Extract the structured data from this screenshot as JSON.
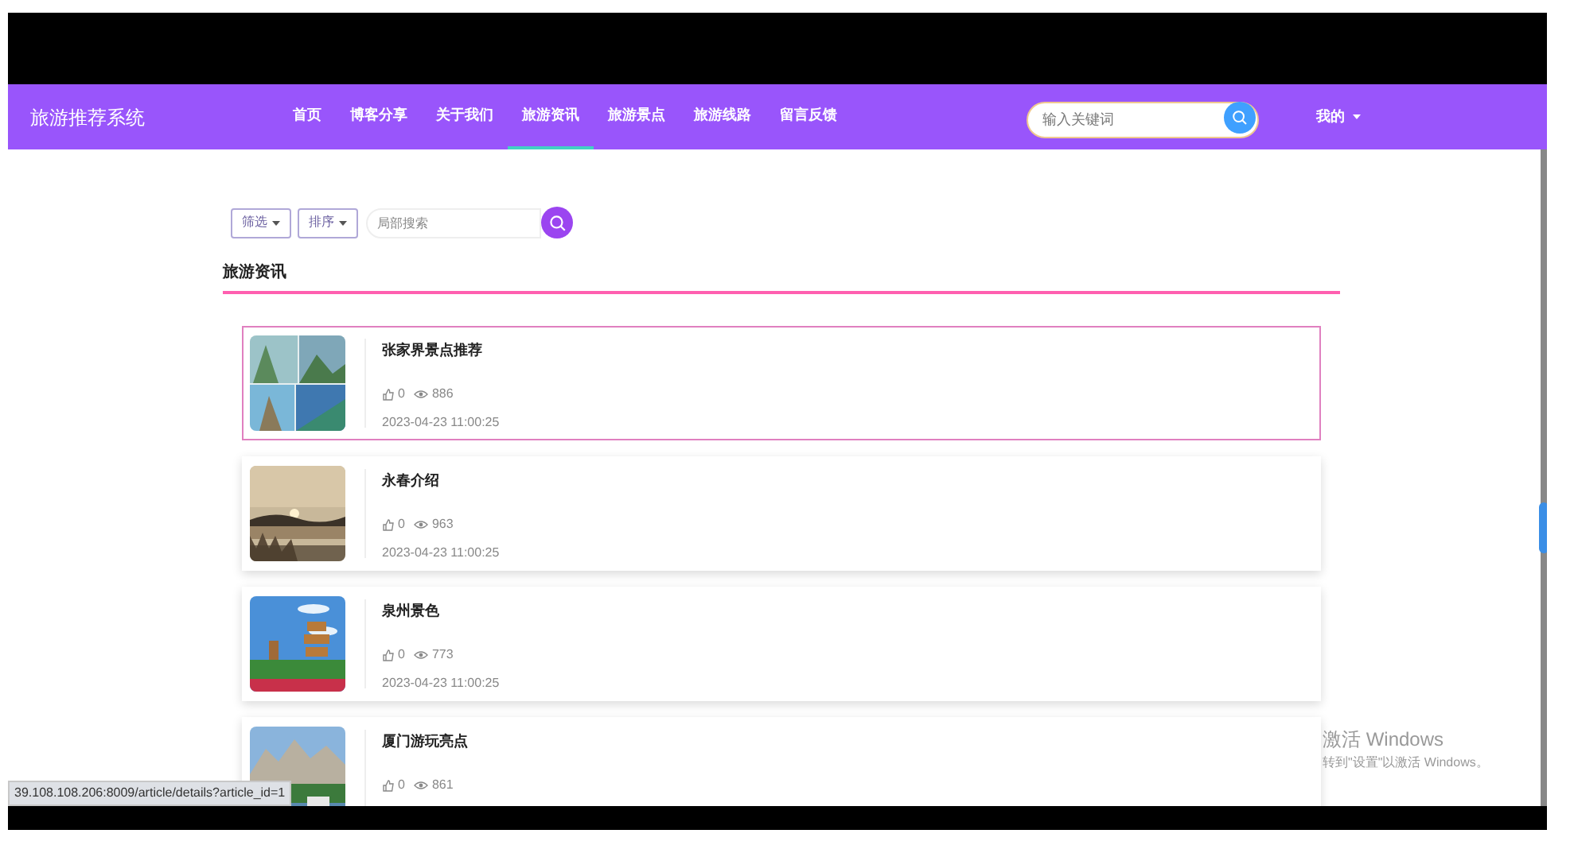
{
  "header": {
    "brand": "旅游推荐系统",
    "nav": [
      {
        "label": "首页",
        "selected": false
      },
      {
        "label": "博客分享",
        "selected": false
      },
      {
        "label": "关于我们",
        "selected": false
      },
      {
        "label": "旅游资讯",
        "selected": true
      },
      {
        "label": "旅游景点",
        "selected": false
      },
      {
        "label": "旅游线路",
        "selected": false
      },
      {
        "label": "留言反馈",
        "selected": false
      }
    ],
    "search": {
      "placeholder": "输入关键词"
    },
    "user_menu": "我的"
  },
  "toolbar": {
    "dropdowns": [
      "筛选",
      "排序"
    ],
    "search": {
      "placeholder": "局部搜索"
    }
  },
  "section_title": "旅游资讯",
  "articles": [
    {
      "title": "张家界景点推荐",
      "likes": "0",
      "views": "886",
      "date": "2023-04-23 11:00:25",
      "hovered": true
    },
    {
      "title": "永春介绍",
      "likes": "0",
      "views": "963",
      "date": "2023-04-23 11:00:25",
      "hovered": false
    },
    {
      "title": "泉州景色",
      "likes": "0",
      "views": "773",
      "date": "2023-04-23 11:00:25",
      "hovered": false
    },
    {
      "title": "厦门游玩亮点",
      "likes": "0",
      "views": "861",
      "hovered": false
    }
  ],
  "status_url": "39.108.108.206:8009/article/details?article_id=1",
  "windows_notice": {
    "title": "激活 Windows",
    "subtitle": "转到\"设置\"以激活 Windows。"
  }
}
